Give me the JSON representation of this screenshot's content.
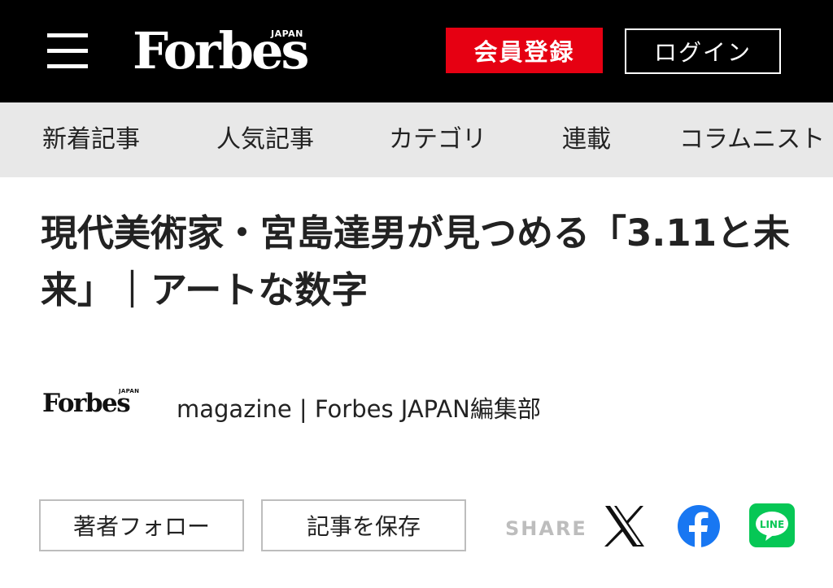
{
  "header": {
    "logo_text": "Forbes",
    "logo_sub": "JAPAN",
    "register_label": "会員登録",
    "login_label": "ログイン"
  },
  "nav": {
    "items": [
      {
        "label": "新着記事"
      },
      {
        "label": "人気記事"
      },
      {
        "label": "カテゴリ"
      },
      {
        "label": "連載"
      },
      {
        "label": "コラムニスト"
      }
    ]
  },
  "article": {
    "title": "現代美術家・宮島達男が見つめる「3.11と未来」｜アートな数字"
  },
  "byline": {
    "logo_text": "Forbes",
    "logo_sub": "JAPAN",
    "text": "magazine | Forbes JAPAN編集部"
  },
  "actions": {
    "follow_label": "著者フォロー",
    "save_label": "記事を保存",
    "share_label": "SHARE"
  },
  "share_icons": {
    "x": "x-icon",
    "facebook": "facebook-icon",
    "line": "line-icon",
    "line_text": "LINE"
  },
  "colors": {
    "header_bg": "#000000",
    "register_red": "#e60012",
    "nav_bg": "#e8e8e8",
    "facebook_blue": "#1877f2",
    "line_green": "#06c755"
  }
}
